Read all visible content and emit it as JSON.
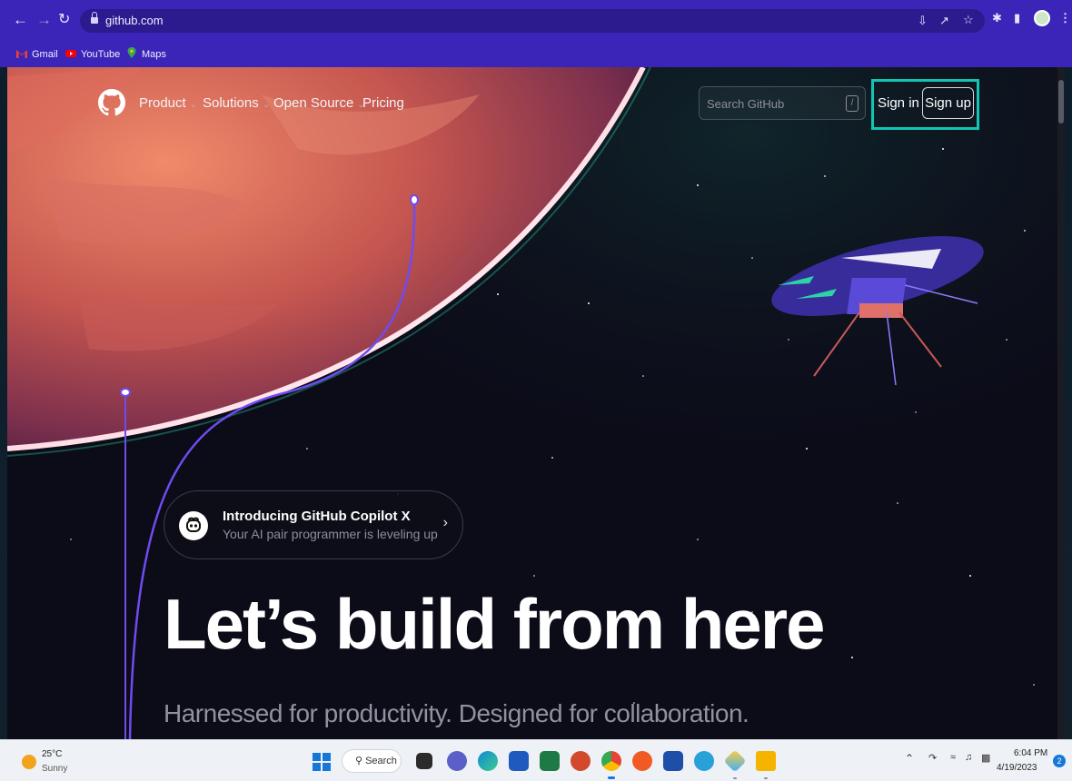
{
  "browser": {
    "url": "github.com",
    "bookmarks": [
      {
        "label": "Gmail",
        "icon": "gmail-icon"
      },
      {
        "label": "YouTube",
        "icon": "youtube-icon"
      },
      {
        "label": "Maps",
        "icon": "maps-icon"
      }
    ]
  },
  "nav": {
    "items": [
      {
        "label": "Product"
      },
      {
        "label": "Solutions"
      },
      {
        "label": "Open Source"
      },
      {
        "label": "Pricing"
      }
    ],
    "search_placeholder": "Search GitHub",
    "search_shortcut": "/",
    "signin_label": "Sign in",
    "signup_label": "Sign up"
  },
  "promo": {
    "title": "Introducing GitHub Copilot X",
    "subtitle": "Your AI pair programmer is leveling up"
  },
  "hero": {
    "title": "Let’s build from here",
    "subtitle": "Harnessed for productivity. Designed for collaboration."
  },
  "taskbar": {
    "weather_temp": "25°C",
    "weather_cond": "Sunny",
    "search_label": "Search",
    "time": "6:04 PM",
    "date": "4/19/2023",
    "notification_count": "2"
  },
  "colors": {
    "browser_chrome": "#3b25b8",
    "highlight_box": "#12c4b4",
    "page_bg": "#0c0b18"
  }
}
